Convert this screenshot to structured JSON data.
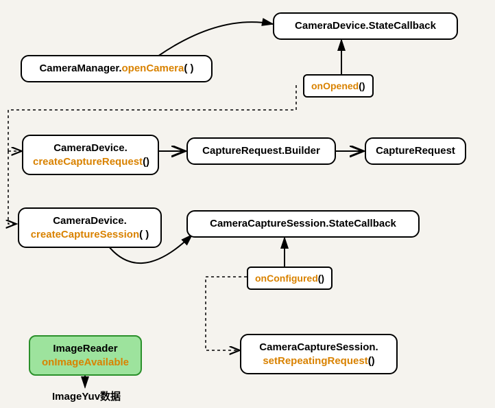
{
  "nodes": {
    "stateCallback": {
      "text": "CameraDevice.StateCallback"
    },
    "openCamera": {
      "prefix": "CameraManager.",
      "method": "openCamera",
      "suffix": "( )"
    },
    "onOpened": {
      "method": "onOpened",
      "suffix": "()"
    },
    "createCaptureRequest": {
      "prefix": "CameraDevice.",
      "method": "createCaptureRequest",
      "suffix": "()"
    },
    "captureRequestBuilder": {
      "text": "CaptureRequest.Builder"
    },
    "captureRequest": {
      "text": "CaptureRequest"
    },
    "createCaptureSession": {
      "prefix": "CameraDevice.",
      "method": "createCaptureSession",
      "suffix": "( )"
    },
    "sessionStateCallback": {
      "text": "CameraCaptureSession.StateCallback"
    },
    "onConfigured": {
      "method": "onConfigured",
      "suffix": "()"
    },
    "setRepeatingRequest": {
      "prefix": "CameraCaptureSession.",
      "method": "setRepeatingRequest",
      "suffix": "()"
    },
    "imageReader": {
      "prefix": "ImageReader",
      "method": "onImageAvailable"
    },
    "imageYuv": {
      "text": "ImageYuv数据"
    }
  }
}
